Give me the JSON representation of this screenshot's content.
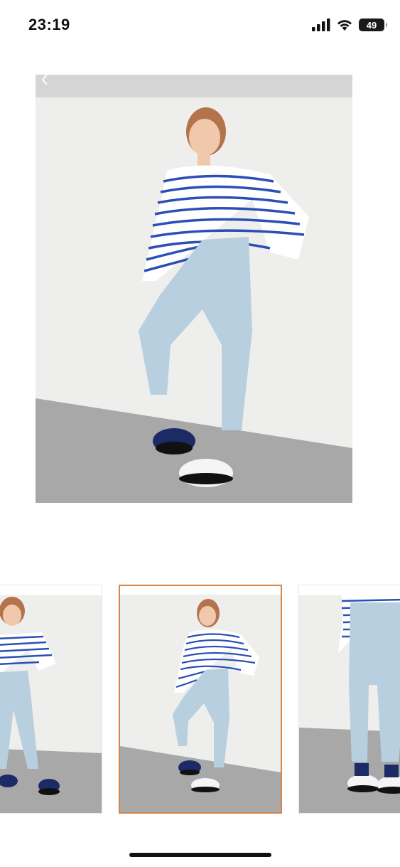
{
  "status_bar": {
    "time": "23:19",
    "battery": "49",
    "icons": [
      "signal-icon",
      "wifi-icon",
      "battery-icon"
    ]
  },
  "gallery": {
    "main_image_alt": "",
    "selected_index": 1,
    "thumbnails": [
      "",
      "",
      ""
    ],
    "selected_border_color": "#d8854a"
  }
}
